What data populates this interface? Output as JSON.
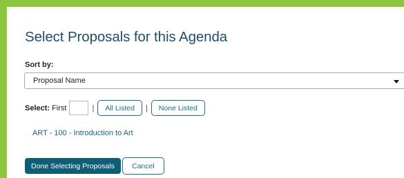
{
  "dialog": {
    "title": "Select Proposals for this Agenda"
  },
  "sort": {
    "label": "Sort by:",
    "selected": "Proposal Name"
  },
  "select_row": {
    "label": "Select:",
    "first_label": "First",
    "first_value": "",
    "separator": "|",
    "all_listed": "All Listed",
    "none_listed": "None Listed"
  },
  "proposals": [
    {
      "label": "ART - 100 - Introduction to Art"
    }
  ],
  "actions": {
    "done": "Done Selecting Proposals",
    "cancel": "Cancel"
  },
  "colors": {
    "frame_border": "#8cc63f",
    "title": "#1f4e66",
    "primary": "#0f5e76",
    "link": "#1e5f7a"
  }
}
